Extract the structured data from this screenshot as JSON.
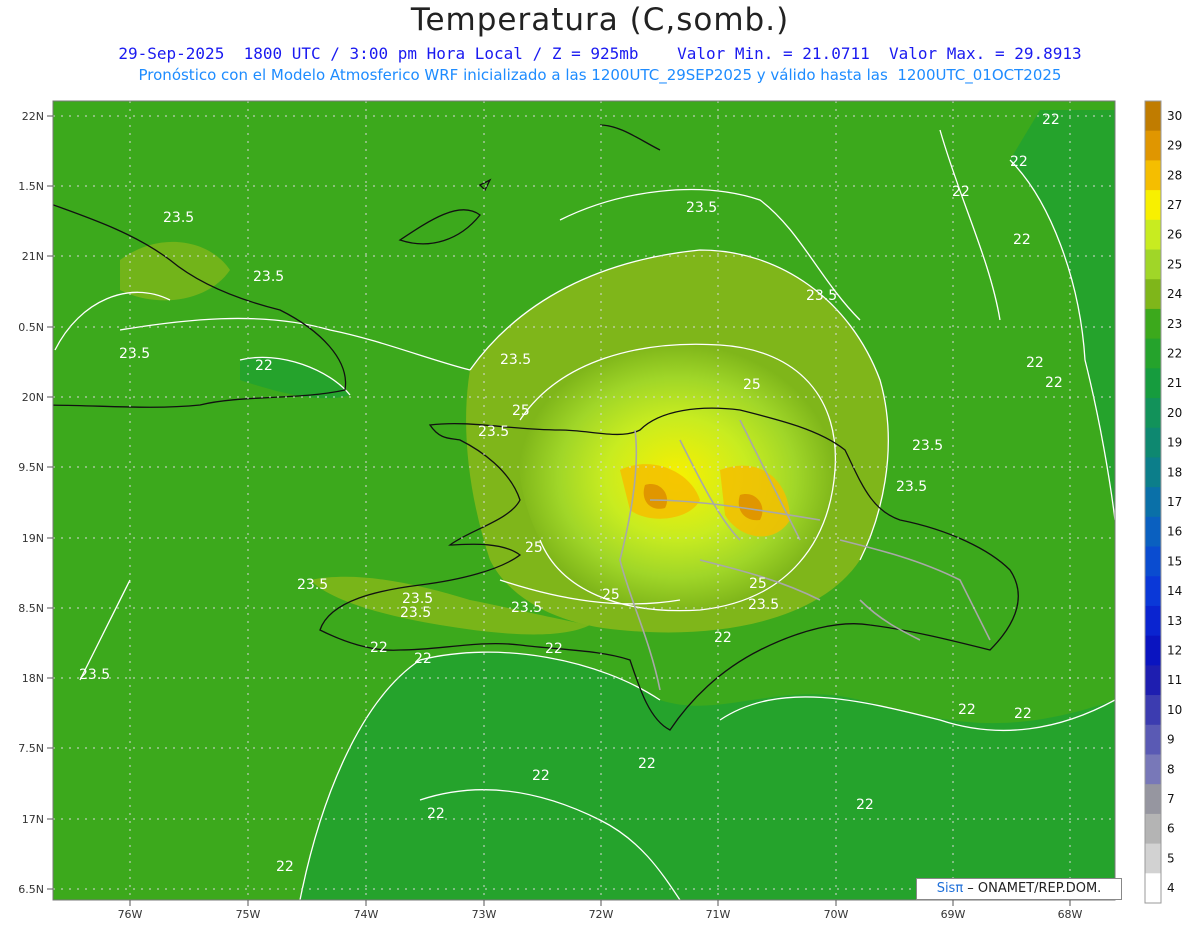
{
  "title": "Temperatura (C,somb.)",
  "subtitle_line1": "29-Sep-2025  1800 UTC / 3:00 pm Hora Local / Z = 925mb    Valor Min. = 21.0711  Valor Max. = 29.8913",
  "subtitle_line2": "Pronóstico con el Modelo Atmosferico WRF inicializado a las 1200UTC_29SEP2025 y válido hasta las  1200UTC_01OCT2025",
  "credit": {
    "brand": "Sisπ",
    "text": " – ONAMET/REP.DOM."
  },
  "axes": {
    "lat_labels": [
      "22N",
      "1.5N",
      "21N",
      "0.5N",
      "20N",
      "9.5N",
      "19N",
      "8.5N",
      "18N",
      "7.5N",
      "17N",
      "6.5N"
    ],
    "lon_labels": [
      "76W",
      "75W",
      "74W",
      "73W",
      "72W",
      "71W",
      "70W",
      "69W",
      "68W"
    ]
  },
  "colorbar": {
    "labels": [
      "30",
      "29",
      "28",
      "27",
      "26",
      "25",
      "24",
      "23",
      "22",
      "21",
      "20",
      "19",
      "18",
      "17",
      "16",
      "15",
      "14",
      "13",
      "12",
      "11",
      "10",
      "9",
      "8",
      "7",
      "6",
      "5",
      "4"
    ],
    "colors": [
      "#c07c00",
      "#e09600",
      "#f5be00",
      "#f8f000",
      "#c8ec20",
      "#a0d628",
      "#7fb61a",
      "#3ca91c",
      "#25a32c",
      "#169c3e",
      "#12925a",
      "#0e8870",
      "#0c7e8a",
      "#0a70a8",
      "#0a60c0",
      "#0a4cd0",
      "#0a38d8",
      "#0a24d0",
      "#0a14c0",
      "#1e1eb0",
      "#3c3cb0",
      "#5a5ab4",
      "#7878b8",
      "#9696a0",
      "#b4b4b4",
      "#d2d2d2",
      "#ffffff"
    ]
  },
  "contour_labels": [
    "22",
    "22",
    "22",
    "22",
    "22",
    "22",
    "22",
    "22",
    "22",
    "22",
    "22",
    "22",
    "22",
    "22",
    "22",
    "22",
    "22",
    "22",
    "23.5",
    "23.5",
    "23.5",
    "23.5",
    "23.5",
    "23.5",
    "23.5",
    "23.5",
    "23.5",
    "23.5",
    "23.5",
    "23.5",
    "23.5",
    "23.5",
    "23.5",
    "25",
    "25",
    "25",
    "25",
    "25"
  ]
}
